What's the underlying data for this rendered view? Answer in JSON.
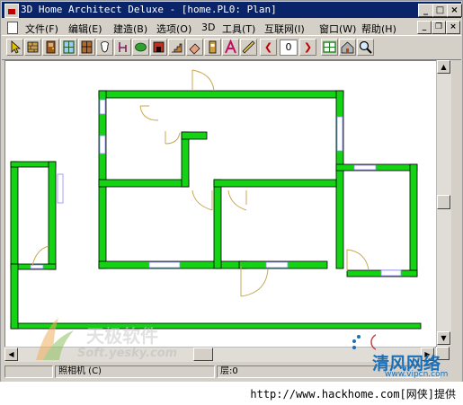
{
  "window": {
    "title": "3D Home Architect Deluxe - [home.PL0: Plan]",
    "controls": {
      "minimize": "_",
      "maximize": "□",
      "close": "×"
    }
  },
  "menubar": {
    "items": [
      "文件(F)",
      "编辑(E)",
      "建造(B)",
      "选项(O)",
      "3D",
      "工具(T)",
      "互联网(I)",
      "窗口(W)",
      "帮助(H)"
    ],
    "doc_controls": {
      "minimize": "_",
      "restore": "❐",
      "close": "×"
    }
  },
  "toolbar": {
    "floor_number": "0",
    "tools": [
      {
        "icon": "select-arrow-icon"
      },
      {
        "icon": "wall-tool-icon"
      },
      {
        "icon": "door-tool-icon"
      },
      {
        "icon": "window-tool-icon"
      },
      {
        "icon": "cabinet-tool-icon"
      },
      {
        "icon": "fixture-tool-icon"
      },
      {
        "icon": "furniture-tool-icon"
      },
      {
        "icon": "landscape-tool-icon"
      },
      {
        "icon": "fireplace-tool-icon"
      },
      {
        "icon": "stairs-tool-icon"
      },
      {
        "icon": "eraser-tool-icon"
      },
      {
        "icon": "library-tool-icon"
      },
      {
        "icon": "text-tool-icon"
      },
      {
        "icon": "dimension-tool-icon"
      },
      {
        "icon": "floor-down-icon"
      },
      {
        "icon": "floor-up-icon"
      },
      {
        "icon": "layout-view-icon"
      },
      {
        "icon": "camera-view-icon"
      },
      {
        "icon": "zoom-icon"
      }
    ]
  },
  "colors": {
    "wall": "#14d214",
    "wall_outline": "#000000",
    "window_glass": "#8c8cff",
    "door_swing": "#c8a850",
    "title_bar": "#0a246a",
    "footer_link": "#000000"
  },
  "status": {
    "mode": "照相机 (C)",
    "floor": "层:0"
  },
  "footer": {
    "text": "http://www.hackhome.com[网侠]提供"
  },
  "watermarks": {
    "left_brand": "天极软件",
    "left_url": "Soft.yesky.com",
    "right_brand": "清风网络",
    "right_url": "www.vipcn.com"
  }
}
